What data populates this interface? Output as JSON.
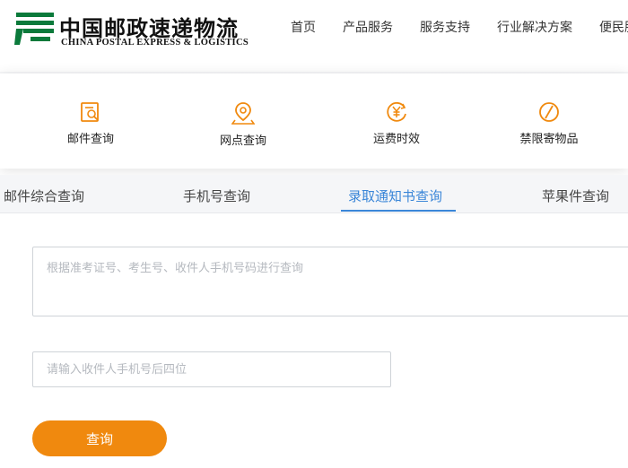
{
  "brand": {
    "name_cn": "中国邮政速递物流",
    "name_en": "CHINA POSTAL EXPRESS & LOGISTICS",
    "color": "#0b7a3b"
  },
  "nav": {
    "items": [
      {
        "label": "首页"
      },
      {
        "label": "产品服务"
      },
      {
        "label": "服务支持"
      },
      {
        "label": "行业解决方案"
      },
      {
        "label": "便民服务"
      }
    ]
  },
  "quick_links": {
    "accent": "#f0890e",
    "items": [
      {
        "label": "邮件查询",
        "icon": "mail-search-icon"
      },
      {
        "label": "网点查询",
        "icon": "location-pin-icon"
      },
      {
        "label": "运费时效",
        "icon": "yuan-clock-icon"
      },
      {
        "label": "禁限寄物品",
        "icon": "prohibited-icon"
      }
    ]
  },
  "tabs": {
    "active_color": "#3a86d8",
    "items": [
      {
        "label": "邮件综合查询",
        "active": false
      },
      {
        "label": "手机号查询",
        "active": false
      },
      {
        "label": "录取通知书查询",
        "active": true
      },
      {
        "label": "苹果件查询",
        "active": false
      }
    ]
  },
  "form": {
    "query_placeholder": "根据准考证号、考生号、收件人手机号码进行查询",
    "query_value": "",
    "phone_placeholder": "请输入收件人手机号后四位",
    "phone_value": "",
    "submit_label": "查询",
    "submit_color": "#f0890e"
  }
}
